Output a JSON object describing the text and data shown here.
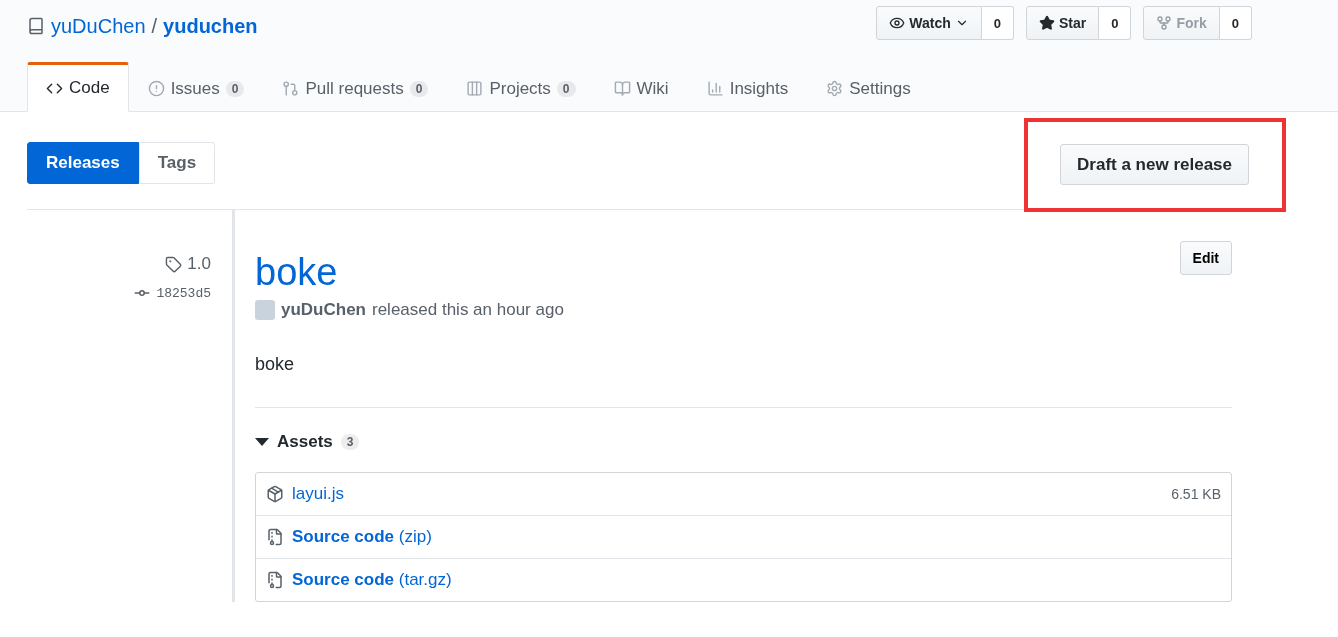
{
  "repo": {
    "owner": "yuDuChen",
    "separator": "/",
    "name": "yuduchen"
  },
  "actions": [
    {
      "kind": "watch",
      "label": "Watch",
      "count": "0",
      "disabled": false
    },
    {
      "kind": "star",
      "label": "Star",
      "count": "0",
      "disabled": false
    },
    {
      "kind": "fork",
      "label": "Fork",
      "count": "0",
      "disabled": true
    }
  ],
  "tabs": [
    {
      "kind": "code",
      "label": "Code",
      "selected": true
    },
    {
      "kind": "issues",
      "label": "Issues",
      "count": "0",
      "selected": false
    },
    {
      "kind": "pulls",
      "label": "Pull requests",
      "count": "0",
      "selected": false
    },
    {
      "kind": "projects",
      "label": "Projects",
      "count": "0",
      "selected": false
    },
    {
      "kind": "wiki",
      "label": "Wiki",
      "selected": false
    },
    {
      "kind": "insights",
      "label": "Insights",
      "selected": false
    },
    {
      "kind": "settings",
      "label": "Settings",
      "selected": false
    }
  ],
  "subnav": [
    {
      "label": "Releases",
      "selected": true
    },
    {
      "label": "Tags",
      "selected": false
    }
  ],
  "draft_button": {
    "label": "Draft a new release",
    "highlighted": true
  },
  "release": {
    "tag": "1.0",
    "commit": "18253d5",
    "title": "boke",
    "edit_label": "Edit",
    "author": "yuDuChen",
    "meta": "released this an hour ago",
    "body": "boke",
    "assets": {
      "label": "Assets",
      "count": "3",
      "expanded": true,
      "items": [
        {
          "kind": "package",
          "name": "layui.js",
          "size": "6.51 KB"
        },
        {
          "kind": "archive",
          "name": "**Source code** (zip)"
        },
        {
          "kind": "archive",
          "name": "**Source code** (tar.gz)"
        }
      ]
    }
  }
}
